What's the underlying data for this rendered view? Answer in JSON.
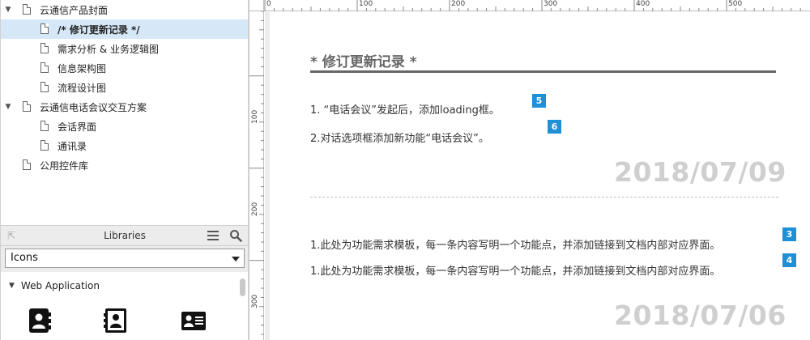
{
  "tree": {
    "items": [
      {
        "label": "云通信产品封面",
        "level": 0,
        "expanded": true,
        "selected": false
      },
      {
        "label": "/* 修订更新记录 */",
        "level": 1,
        "selected": true
      },
      {
        "label": "需求分析 & 业务逻辑图",
        "level": 1,
        "selected": false
      },
      {
        "label": "信息架构图",
        "level": 1,
        "selected": false
      },
      {
        "label": "流程设计图",
        "level": 1,
        "selected": false
      },
      {
        "label": "云通信电话会议交互方案",
        "level": 0,
        "expanded": true,
        "selected": false
      },
      {
        "label": "会话界面",
        "level": 1,
        "selected": false
      },
      {
        "label": "通讯录",
        "level": 1,
        "selected": false
      },
      {
        "label": "公用控件库",
        "level": 0,
        "selected": false
      }
    ]
  },
  "libraries": {
    "title": "Libraries",
    "selected_library": "Icons",
    "group_label": "Web Application",
    "icons": [
      "address-book-icon",
      "contact-card-icon",
      "id-card-icon"
    ]
  },
  "rulers": {
    "top": [
      "0",
      "100",
      "200",
      "300",
      "400",
      "500"
    ],
    "left": [
      "100",
      "200",
      "300"
    ]
  },
  "document": {
    "title": "* 修订更新记录 *",
    "sections": [
      {
        "items": [
          {
            "text": "1. “电话会议”发起后，添加loading框。",
            "badge": "5"
          },
          {
            "text": "2.对话选项框添加新功能“电话会议”。",
            "badge": "6"
          }
        ],
        "date": "2018/07/09"
      },
      {
        "items": [
          {
            "text": "1.此处为功能需求模板，每一条内容写明一个功能点，并添加链接到文档内部对应界面。",
            "badge": "3"
          },
          {
            "text": "1.此处为功能需求模板，每一条内容写明一个功能点，并添加链接到文档内部对应界面。",
            "badge": "4"
          }
        ],
        "date": "2018/07/06"
      }
    ]
  },
  "colors": {
    "selection": "#d6e8f7",
    "badge": "#1f8fd6",
    "date": "#cfcfcf",
    "title": "#666666"
  }
}
